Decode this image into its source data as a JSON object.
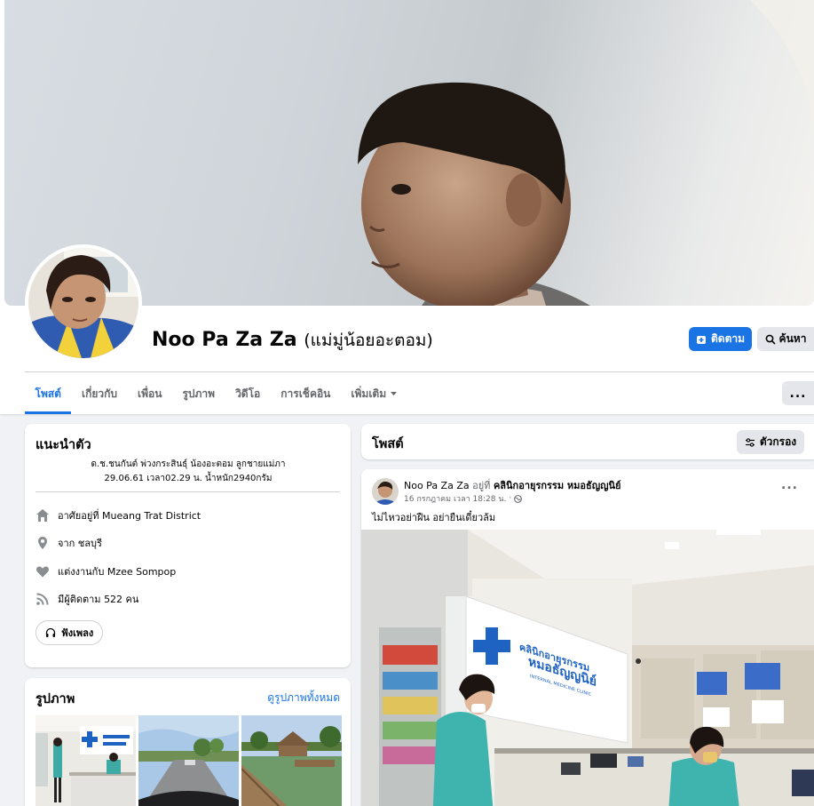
{
  "profile": {
    "name": "Noo Pa Za Za",
    "alt_name": "(แม่มู่น้อยอะตอม)",
    "follow_label": "ติดตาม",
    "search_label": "ค้นหา"
  },
  "tabs": [
    {
      "label": "โพสต์"
    },
    {
      "label": "เกี่ยวกับ"
    },
    {
      "label": "เพื่อน"
    },
    {
      "label": "รูปภาพ"
    },
    {
      "label": "วิดีโอ"
    },
    {
      "label": "การเช็คอิน"
    },
    {
      "label": "เพิ่มเติม"
    }
  ],
  "more_menu_label": "...",
  "intro": {
    "title": "แนะนำตัว",
    "bio_line1": "ด.ช.ชนกันต์ พ่วงกระสินธุ์ น้องอะตอม ลูกชายแม่ภา",
    "bio_line2": "29.06.61 เวลา02.29 น. น้ำหนัก2940กรัม",
    "lives_prefix": "อาศัยอยู่ที่",
    "lives_place": "Mueang Trat District",
    "from_prefix": "จาก",
    "from_place": "ชลบุรี",
    "married_prefix": "แต่งงานกับ",
    "married_name": "Mzee Sompop",
    "followers_prefix": "มีผู้ติดตาม",
    "followers_count": "522 คน",
    "music_label": "ฟังเพลง"
  },
  "photos": {
    "title": "รูปภาพ",
    "see_all": "ดูรูปภาพทั้งหมด"
  },
  "posts_header": {
    "title": "โพสต์",
    "filter_label": "ตัวกรอง"
  },
  "post": {
    "author": "Noo Pa Za Za",
    "at_text": "อยู่ที่",
    "place": "คลินิกอายุรกรรม หมอธัญญนิย์",
    "timestamp": "16 กรกฎาคม เวลา 18:28 น.",
    "dot": "·",
    "menu": "...",
    "text": "ไม่ไหวอย่าฝืน อย่ายืนเดี๋ยวล้ม",
    "sign_line1": "คลินิกอายุรกรรม",
    "sign_line2": "หมอธัญญนิย์",
    "sign_line3": "INTERNAL MEDICINE CLINIC"
  },
  "colors": {
    "accent": "#1b74e4",
    "page_bg": "#f0f2f5",
    "button_gray": "#e4e6eb",
    "muted_text": "#65676b"
  }
}
